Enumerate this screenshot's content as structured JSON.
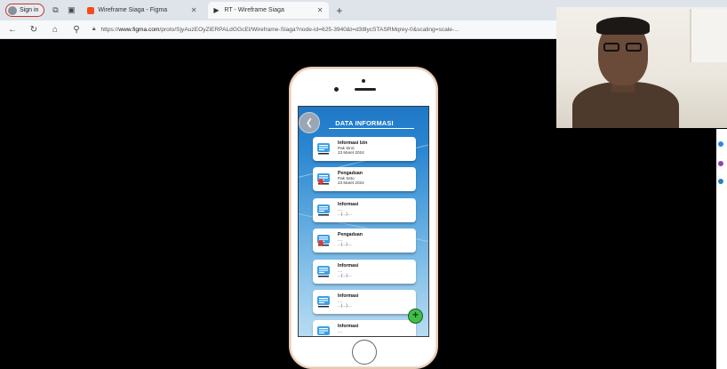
{
  "browser": {
    "signin_label": "Sign in",
    "tabs": [
      {
        "title": "Wireframe Siaga - Figma",
        "color": "#f24e1e",
        "active": false
      },
      {
        "title": "RT - Wireframe Siaga",
        "color": "#222222",
        "active": true
      }
    ],
    "new_tab": "+",
    "url": {
      "prefix": "https://",
      "domain": "www.figma.com",
      "path": "/proto/SjyAuzEOyZiERPALdGGcEl/Wireframe-Siaga?node-id=625-3940&t=d38lycSTASRMqrey-0&scaling=scale-..."
    },
    "reader_label": "A"
  },
  "app": {
    "header_title": "DATA INFORMASI",
    "cards": [
      {
        "title": "Informasi Izin",
        "line2": "Pak Sirot",
        "line3": "23 Maret 2024",
        "icon": "message-icon",
        "color": "#2e8fe0"
      },
      {
        "title": "Pengaduan",
        "line2": "Pak Seto",
        "line3": "23 Maret 2024",
        "icon": "complaint-icon",
        "color": "#e53935"
      },
      {
        "title": "Informasi",
        "line2": "....",
        "line3": "...(...)....",
        "icon": "message-icon",
        "color": "#2e8fe0"
      },
      {
        "title": "Pengaduan",
        "line2": "....",
        "line3": "...(...)....",
        "icon": "complaint-icon",
        "color": "#e53935"
      },
      {
        "title": "Informasi",
        "line2": "....",
        "line3": "...(...)....",
        "icon": "message-icon",
        "color": "#2e8fe0"
      },
      {
        "title": "Informasi",
        "line2": "....",
        "line3": "...(...)....",
        "icon": "message-icon",
        "color": "#2e8fe0"
      },
      {
        "title": "Informasi",
        "line2": "....",
        "line3": "",
        "icon": "message-icon",
        "color": "#2e8fe0"
      }
    ],
    "fab_label": "+",
    "back_label": "❮"
  },
  "colors": {
    "phone_frame": "#e8c9b3",
    "screen_top": "#1f78c6",
    "screen_bottom": "#b8dcf3",
    "fab": "#3fbf4a"
  }
}
